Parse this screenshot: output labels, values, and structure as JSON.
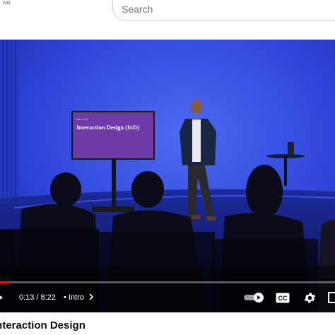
{
  "header": {
    "region_code": "NG",
    "search_placeholder": "Search"
  },
  "player": {
    "slide_small_text": "Intro to UX",
    "slide_title": "Interaction Design (IxD)",
    "time_current": "0:13",
    "time_separator": "/",
    "time_total": "8:22",
    "chapter_bullet": "•",
    "chapter_label": "Intro",
    "progress_fraction": 0.026,
    "accent_color": "#ff0000"
  },
  "video": {
    "title": "Interaction Design"
  },
  "icons": [
    "play-pause-icon",
    "chevron-right-icon",
    "autoplay-toggle-icon",
    "captions-icon",
    "settings-gear-icon",
    "miniplayer-icon"
  ]
}
